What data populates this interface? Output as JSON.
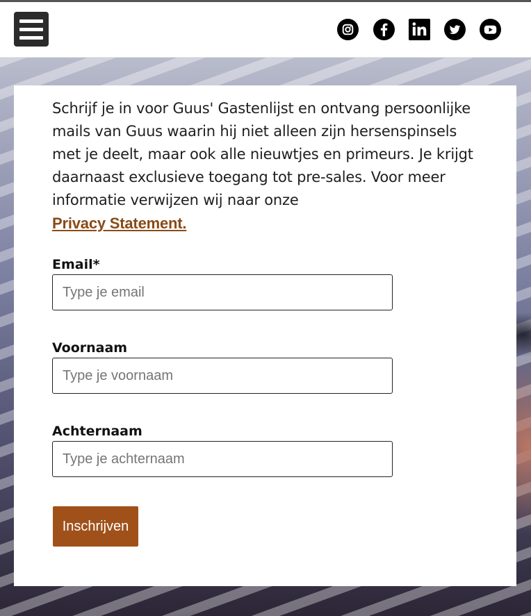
{
  "header": {
    "menu_icon": "hamburger-menu-icon",
    "social": [
      {
        "name": "instagram-icon"
      },
      {
        "name": "facebook-icon"
      },
      {
        "name": "linkedin-icon"
      },
      {
        "name": "twitter-icon"
      },
      {
        "name": "youtube-icon"
      }
    ]
  },
  "signup": {
    "intro": "Schrijf je in voor Guus' Gastenlijst en ontvang persoonlijke mails van Guus waarin hij niet alleen zijn hersenspinsels met je deelt, maar ook alle nieuwtjes en primeurs. Je krijgt daarnaast exclusieve toegang tot pre-sales. Voor meer informatie verwijzen wij naar onze",
    "privacy_link": "Privacy Statement.",
    "email_label": "Email*",
    "email_placeholder": "Type je email",
    "firstname_label": "Voornaam",
    "firstname_placeholder": "Type je voornaam",
    "lastname_label": "Achternaam",
    "lastname_placeholder": "Type je achternaam",
    "submit_label": "Inschrijven"
  },
  "colors": {
    "accent": "#a0511a",
    "link": "#8a4a16",
    "header_bg": "#ffffff",
    "menu_bg": "#2b2b2b"
  }
}
